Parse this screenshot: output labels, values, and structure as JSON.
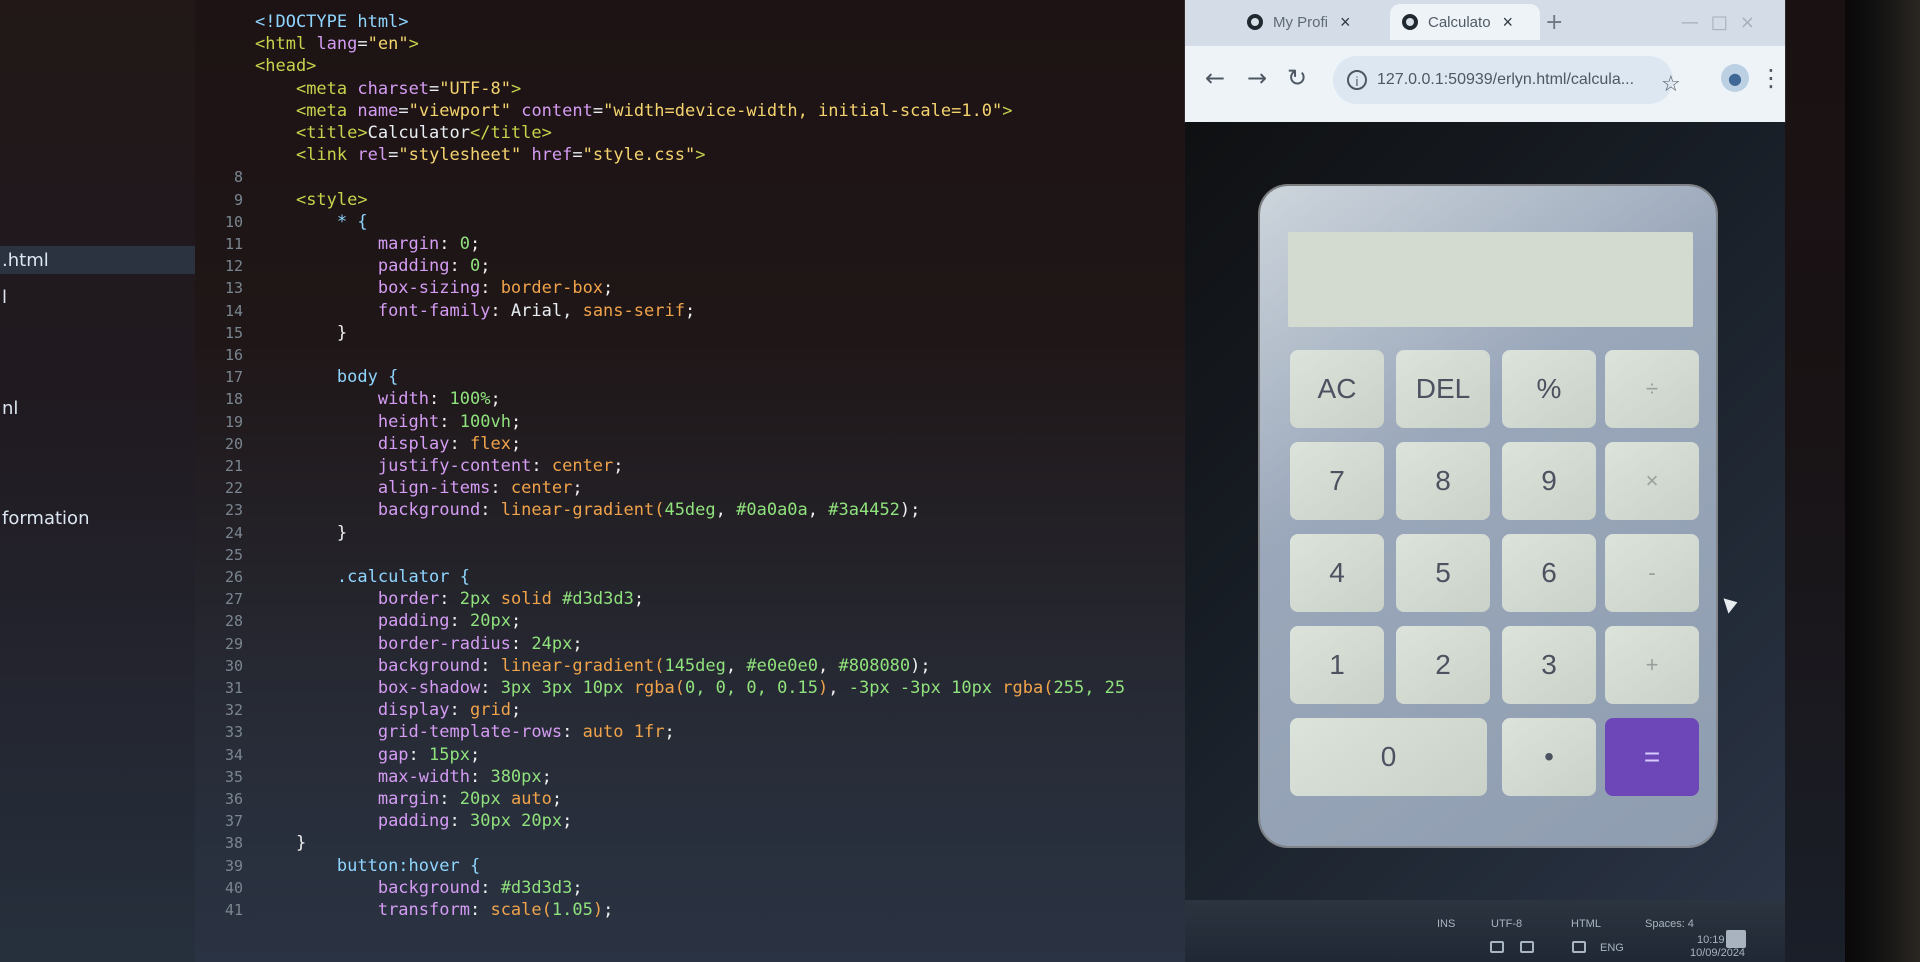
{
  "file_panel": {
    "items": [
      ".html",
      "l",
      "nl",
      "formation"
    ]
  },
  "editor": {
    "lines": [
      {
        "no": "",
        "html": "<span class=\"t-sel\">&lt;!DOCTYPE html&gt;</span>"
      },
      {
        "no": "",
        "html": "<span class=\"t-tag\">&lt;html</span> <span class=\"t-prop\">lang</span>=<span class=\"t-str\">\"en\"</span><span class=\"t-tag\">&gt;</span>"
      },
      {
        "no": "",
        "html": "<span class=\"t-tag\">&lt;head&gt;</span>"
      },
      {
        "no": "",
        "html": "    <span class=\"t-tag\">&lt;meta</span> <span class=\"t-prop\">charset</span>=<span class=\"t-str\">\"UTF-8\"</span><span class=\"t-tag\">&gt;</span>"
      },
      {
        "no": "",
        "html": "    <span class=\"t-tag\">&lt;meta</span> <span class=\"t-prop\">name</span>=<span class=\"t-str\">\"viewport\"</span> <span class=\"t-prop\">content</span>=<span class=\"t-str\">\"width=device-width, initial-scale=1.0\"</span><span class=\"t-tag\">&gt;</span>"
      },
      {
        "no": "",
        "html": "    <span class=\"t-tag\">&lt;title&gt;</span><span class=\"code-text\">Calculator</span><span class=\"t-tag\">&lt;/title&gt;</span>"
      },
      {
        "no": "",
        "html": "    <span class=\"t-tag\">&lt;link</span> <span class=\"t-prop\">rel</span>=<span class=\"t-str\">\"stylesheet\"</span> <span class=\"t-prop\">href</span>=<span class=\"t-str\">\"style.css\"</span><span class=\"t-tag\">&gt;</span>"
      },
      {
        "no": "8",
        "html": ""
      },
      {
        "no": "9",
        "html": "    <span class=\"t-tag\">&lt;style&gt;</span>"
      },
      {
        "no": "10",
        "html": "        <span class=\"t-sel\">* {</span>"
      },
      {
        "no": "11",
        "html": "            <span class=\"t-prop\">margin</span><span class=\"t-punc\">:</span> <span class=\"t-num\">0</span><span class=\"t-punc\">;</span>"
      },
      {
        "no": "12",
        "html": "            <span class=\"t-prop\">padding</span><span class=\"t-punc\">:</span> <span class=\"t-num\">0</span><span class=\"t-punc\">;</span>"
      },
      {
        "no": "13",
        "html": "            <span class=\"t-prop\">box-sizing</span><span class=\"t-punc\">:</span> <span class=\"t-val\">border-box</span><span class=\"t-punc\">;</span>"
      },
      {
        "no": "14",
        "html": "            <span class=\"t-prop\">font-family</span><span class=\"t-punc\">:</span> <span class=\"code-text\">Arial, </span><span class=\"t-val\">sans-serif</span><span class=\"t-punc\">;</span>"
      },
      {
        "no": "15",
        "html": "        <span class=\"t-punc\">}</span>"
      },
      {
        "no": "16",
        "html": ""
      },
      {
        "no": "17",
        "html": "        <span class=\"t-sel\">body {</span>"
      },
      {
        "no": "18",
        "html": "            <span class=\"t-prop\">width</span><span class=\"t-punc\">:</span> <span class=\"t-num\">100%</span><span class=\"t-punc\">;</span>"
      },
      {
        "no": "19",
        "html": "            <span class=\"t-prop\">height</span><span class=\"t-punc\">:</span> <span class=\"t-num\">100vh</span><span class=\"t-punc\">;</span>"
      },
      {
        "no": "20",
        "html": "            <span class=\"t-prop\">display</span><span class=\"t-punc\">:</span> <span class=\"t-val\">flex</span><span class=\"t-punc\">;</span>"
      },
      {
        "no": "21",
        "html": "            <span class=\"t-prop\">justify-content</span><span class=\"t-punc\">:</span> <span class=\"t-val\">center</span><span class=\"t-punc\">;</span>"
      },
      {
        "no": "22",
        "html": "            <span class=\"t-prop\">align-items</span><span class=\"t-punc\">:</span> <span class=\"t-val\">center</span><span class=\"t-punc\">;</span>"
      },
      {
        "no": "23",
        "html": "            <span class=\"t-prop\">background</span><span class=\"t-punc\">:</span> <span class=\"t-val\">linear-gradient(</span><span class=\"t-num\">45deg</span><span class=\"t-punc\">, </span><span class=\"t-num\">#0a0a0a</span><span class=\"t-punc\">, </span><span class=\"t-num\">#3a4452</span><span class=\"t-punc\">);</span>"
      },
      {
        "no": "24",
        "html": "        <span class=\"t-punc\">}</span>"
      },
      {
        "no": "25",
        "html": ""
      },
      {
        "no": "26",
        "html": "        <span class=\"t-sel\">.calculator {</span>"
      },
      {
        "no": "27",
        "html": "            <span class=\"t-prop\">border</span><span class=\"t-punc\">:</span> <span class=\"t-num\">2px</span> <span class=\"t-val\">solid</span> <span class=\"t-num\">#d3d3d3</span><span class=\"t-punc\">;</span>"
      },
      {
        "no": "28",
        "html": "            <span class=\"t-prop\">padding</span><span class=\"t-punc\">:</span> <span class=\"t-num\">20px</span><span class=\"t-punc\">;</span>"
      },
      {
        "no": "29",
        "html": "            <span class=\"t-prop\">border-radius</span><span class=\"t-punc\">:</span> <span class=\"t-num\">24px</span><span class=\"t-punc\">;</span>"
      },
      {
        "no": "30",
        "html": "            <span class=\"t-prop\">background</span><span class=\"t-punc\">:</span> <span class=\"t-val\">linear-gradient(</span><span class=\"t-num\">145deg</span><span class=\"t-punc\">, </span><span class=\"t-num\">#e0e0e0</span><span class=\"t-punc\">, </span><span class=\"t-num\">#808080</span><span class=\"t-punc\">);</span>"
      },
      {
        "no": "31",
        "html": "            <span class=\"t-prop\">box-shadow</span><span class=\"t-punc\">:</span> <span class=\"t-num\">3px 3px 10px</span> <span class=\"t-val\">rgba(</span><span class=\"t-num\">0, 0, 0, 0.15</span><span class=\"t-val\">)</span><span class=\"t-punc\">, </span><span class=\"t-num\">-3px -3px 10px</span> <span class=\"t-val\">rgba(</span><span class=\"t-num\">255, 25</span>"
      },
      {
        "no": "32",
        "html": "            <span class=\"t-prop\">display</span><span class=\"t-punc\">:</span> <span class=\"t-val\">grid</span><span class=\"t-punc\">;</span>"
      },
      {
        "no": "33",
        "html": "            <span class=\"t-prop\">grid-template-rows</span><span class=\"t-punc\">:</span> <span class=\"t-val\">auto 1fr</span><span class=\"t-punc\">;</span>"
      },
      {
        "no": "34",
        "html": "            <span class=\"t-prop\">gap</span><span class=\"t-punc\">:</span> <span class=\"t-num\">15px</span><span class=\"t-punc\">;</span>"
      },
      {
        "no": "35",
        "html": "            <span class=\"t-prop\">max-width</span><span class=\"t-punc\">:</span> <span class=\"t-num\">380px</span><span class=\"t-punc\">;</span>"
      },
      {
        "no": "36",
        "html": "            <span class=\"t-prop\">margin</span><span class=\"t-punc\">:</span> <span class=\"t-num\">20px</span> <span class=\"t-val\">auto</span><span class=\"t-punc\">;</span>"
      },
      {
        "no": "37",
        "html": "            <span class=\"t-prop\">padding</span><span class=\"t-punc\">:</span> <span class=\"t-num\">30px 20px</span><span class=\"t-punc\">;</span>"
      },
      {
        "no": "38",
        "html": "    <span class=\"t-punc\">}</span>"
      },
      {
        "no": "39",
        "html": "        <span class=\"t-sel\">button:hover {</span>"
      },
      {
        "no": "40",
        "html": "            <span class=\"t-prop\">background</span><span class=\"t-punc\">:</span> <span class=\"t-num\">#d3d3d3</span><span class=\"t-punc\">;</span>"
      },
      {
        "no": "41",
        "html": "            <span class=\"t-prop\">transform</span><span class=\"t-punc\">:</span> <span class=\"t-val\">scale(</span><span class=\"t-num\">1.05</span><span class=\"t-val\">)</span><span class=\"t-punc\">;</span>"
      }
    ]
  },
  "browser": {
    "tabs": [
      {
        "label": "My Profi"
      },
      {
        "label": "Calculato"
      }
    ],
    "url": "127.0.0.1:50939/erlyn.html/calcula..."
  },
  "calculator": {
    "display": "",
    "buttons": [
      [
        "AC",
        "DEL",
        "%",
        "÷"
      ],
      [
        "7",
        "8",
        "9",
        "×"
      ],
      [
        "4",
        "5",
        "6",
        "-"
      ],
      [
        "1",
        "2",
        "3",
        "+"
      ],
      [
        "0",
        "•",
        "="
      ]
    ]
  },
  "status_bar": {
    "insert_mode": "INS",
    "encoding": "UTF-8",
    "language": "HTML",
    "tab": "Spaces: 4",
    "language_indicator": "ENG",
    "time": "10:19 AM",
    "date": "10/09/2024"
  },
  "colors": {
    "accent": "#6d46b8",
    "display_bg": "#d3dad0",
    "calculator_bg_start": "#e0e0e0",
    "calculator_bg_end": "#808080"
  }
}
